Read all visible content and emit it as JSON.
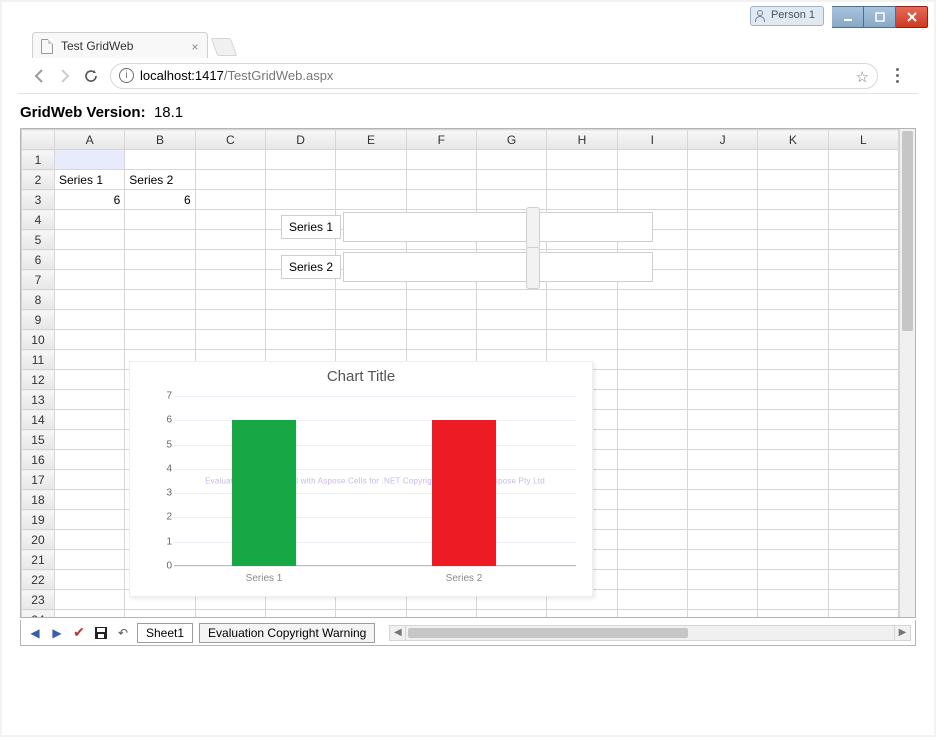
{
  "window": {
    "person_badge": "Person 1"
  },
  "browser_tab": {
    "title": "Test GridWeb"
  },
  "address_bar": {
    "host": "localhost:",
    "port": "1417",
    "path": "/TestGridWeb.aspx"
  },
  "page_header": {
    "label": "GridWeb Version:",
    "value": "18.1"
  },
  "sheet": {
    "columns": [
      "A",
      "B",
      "C",
      "D",
      "E",
      "F",
      "G",
      "H",
      "I",
      "J",
      "K",
      "L"
    ],
    "row_count": 24,
    "cells": {
      "A2": "Series 1",
      "B2": "Series 2",
      "A3": "6",
      "B3": "6"
    },
    "series_labels": {
      "s1": "Series 1",
      "s2": "Series 2"
    }
  },
  "chart_data": {
    "type": "bar",
    "title": "Chart Title",
    "categories": [
      "Series 1",
      "Series 2"
    ],
    "values": [
      6,
      6
    ],
    "series_colors": [
      "#17a744",
      "#ed1c24"
    ],
    "ylim": [
      0,
      7
    ],
    "yticks": [
      0,
      1,
      2,
      3,
      4,
      5,
      6,
      7
    ],
    "xlabel": "",
    "ylabel": "",
    "watermark": "Evaluation Only. Created with Aspose.Cells for .NET Copyright 2003 - 2018 Aspose Pty Ltd"
  },
  "footer": {
    "sheet_tab_active": "Sheet1",
    "sheet_tab_warning": "Evaluation Copyright Warning"
  }
}
